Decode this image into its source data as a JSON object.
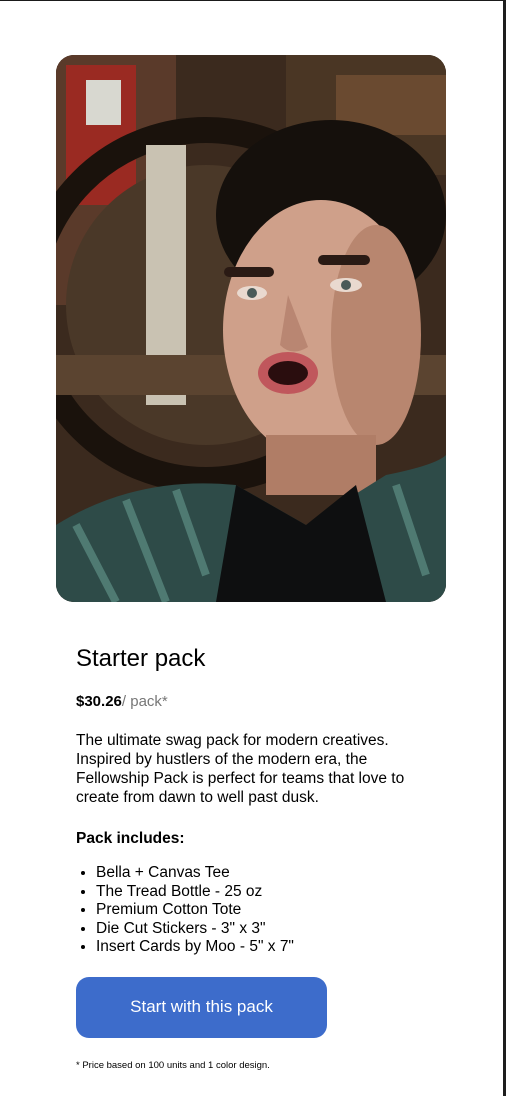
{
  "product": {
    "title": "Starter pack",
    "price": "$30.26",
    "price_unit": "/ pack*",
    "description": "The ultimate swag pack for modern creatives. Inspired by hustlers of the modern era, the Fellowship Pack is perfect for teams that love to create from dawn to well past dusk.",
    "includes_heading": "Pack includes:",
    "includes": [
      "Bella + Canvas Tee",
      "The Tread Bottle - 25 oz",
      "Premium Cotton Tote",
      "Die Cut Stickers - 3\" x 3\"",
      "Insert Cards by Moo - 5\" x 7\""
    ],
    "cta_label": "Start with this pack",
    "footnote": "* Price based on 100 units and 1 color design."
  },
  "colors": {
    "cta_background": "#3d6ccb",
    "cta_text": "#ffffff",
    "price_unit": "#777777"
  }
}
